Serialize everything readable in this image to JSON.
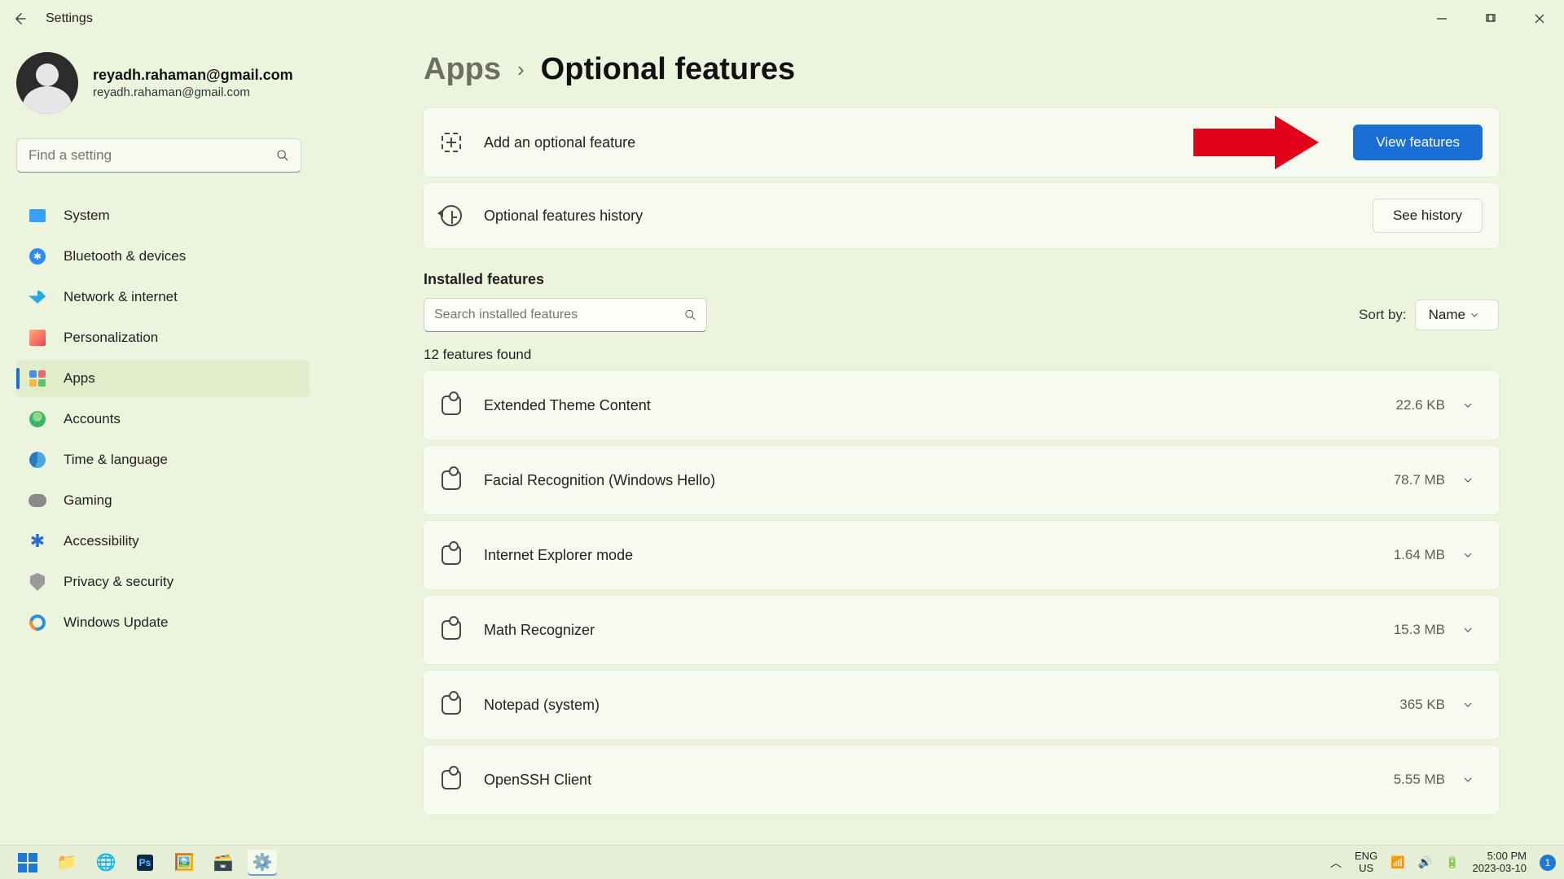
{
  "titlebar": {
    "title": "Settings"
  },
  "profile": {
    "name": "reyadh.rahaman@gmail.com",
    "sub": "reyadh.rahaman@gmail.com"
  },
  "sidebar": {
    "search_placeholder": "Find a setting",
    "items": [
      {
        "label": "System"
      },
      {
        "label": "Bluetooth & devices"
      },
      {
        "label": "Network & internet"
      },
      {
        "label": "Personalization"
      },
      {
        "label": "Apps"
      },
      {
        "label": "Accounts"
      },
      {
        "label": "Time & language"
      },
      {
        "label": "Gaming"
      },
      {
        "label": "Accessibility"
      },
      {
        "label": "Privacy & security"
      },
      {
        "label": "Windows Update"
      }
    ]
  },
  "breadcrumb": {
    "parent": "Apps",
    "current": "Optional features"
  },
  "actions": {
    "add_label": "Add an optional feature",
    "view_btn": "View features",
    "history_label": "Optional features history",
    "history_btn": "See history"
  },
  "installed": {
    "title": "Installed features",
    "search_placeholder": "Search installed features",
    "sort_label": "Sort by:",
    "sort_value": "Name",
    "count_text": "12 features found",
    "items": [
      {
        "name": "Extended Theme Content",
        "size": "22.6 KB"
      },
      {
        "name": "Facial Recognition (Windows Hello)",
        "size": "78.7 MB"
      },
      {
        "name": "Internet Explorer mode",
        "size": "1.64 MB"
      },
      {
        "name": "Math Recognizer",
        "size": "15.3 MB"
      },
      {
        "name": "Notepad (system)",
        "size": "365 KB"
      },
      {
        "name": "OpenSSH Client",
        "size": "5.55 MB"
      }
    ]
  },
  "taskbar": {
    "lang_top": "ENG",
    "lang_bot": "US",
    "time": "5:00 PM",
    "date": "2023-03-10",
    "badge": "1"
  }
}
